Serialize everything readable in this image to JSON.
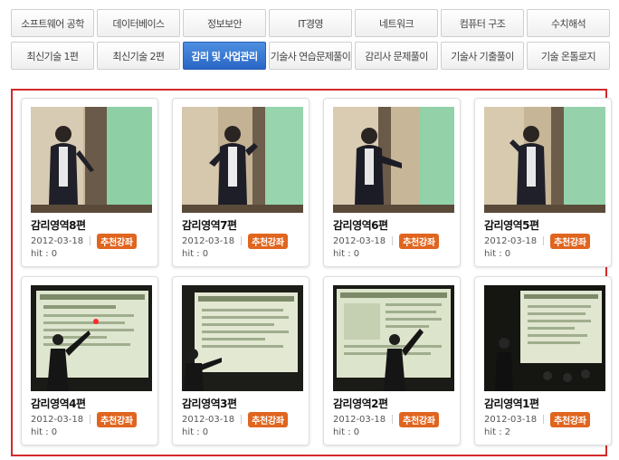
{
  "tabs": {
    "row1": [
      "소프트웨어 공학",
      "데이터베이스",
      "정보보안",
      "IT경영",
      "네트워크",
      "컴퓨터 구조",
      "수치해석"
    ],
    "row2": [
      "최신기술 1편",
      "최신기술 2편",
      "감리 및 사업관리",
      "기술사 연습문제풀이",
      "감리사 문제풀이",
      "기술사 기출풀이",
      "기술 온톨로지"
    ],
    "active": "감리 및 사업관리"
  },
  "lectures": [
    {
      "title": "감리영역8편",
      "date": "2012-03-18",
      "badge": "추천강좌",
      "hit": "hit : 0",
      "thumb_icon": "speaker-photo"
    },
    {
      "title": "감리영역7편",
      "date": "2012-03-18",
      "badge": "추천강좌",
      "hit": "hit : 0",
      "thumb_icon": "speaker-photo"
    },
    {
      "title": "감리영역6편",
      "date": "2012-03-18",
      "badge": "추천강좌",
      "hit": "hit : 0",
      "thumb_icon": "speaker-photo"
    },
    {
      "title": "감리영역5편",
      "date": "2012-03-18",
      "badge": "추천강좌",
      "hit": "hit : 0",
      "thumb_icon": "speaker-photo"
    },
    {
      "title": "감리영역4편",
      "date": "2012-03-18",
      "badge": "추천강좌",
      "hit": "hit : 0",
      "thumb_icon": "presentation-slide-photo"
    },
    {
      "title": "감리영역3편",
      "date": "2012-03-18",
      "badge": "추천강좌",
      "hit": "hit : 0",
      "thumb_icon": "presentation-slide-photo"
    },
    {
      "title": "감리영역2편",
      "date": "2012-03-18",
      "badge": "추천강좌",
      "hit": "hit : 0",
      "thumb_icon": "presentation-slide-photo"
    },
    {
      "title": "감리영역1편",
      "date": "2012-03-18",
      "badge": "추천강좌",
      "hit": "hit : 2",
      "thumb_icon": "presentation-slide-photo"
    }
  ],
  "colors": {
    "active_tab": "#3a7bd5",
    "panel_border": "#d32a2a",
    "badge": "#e0651f"
  }
}
